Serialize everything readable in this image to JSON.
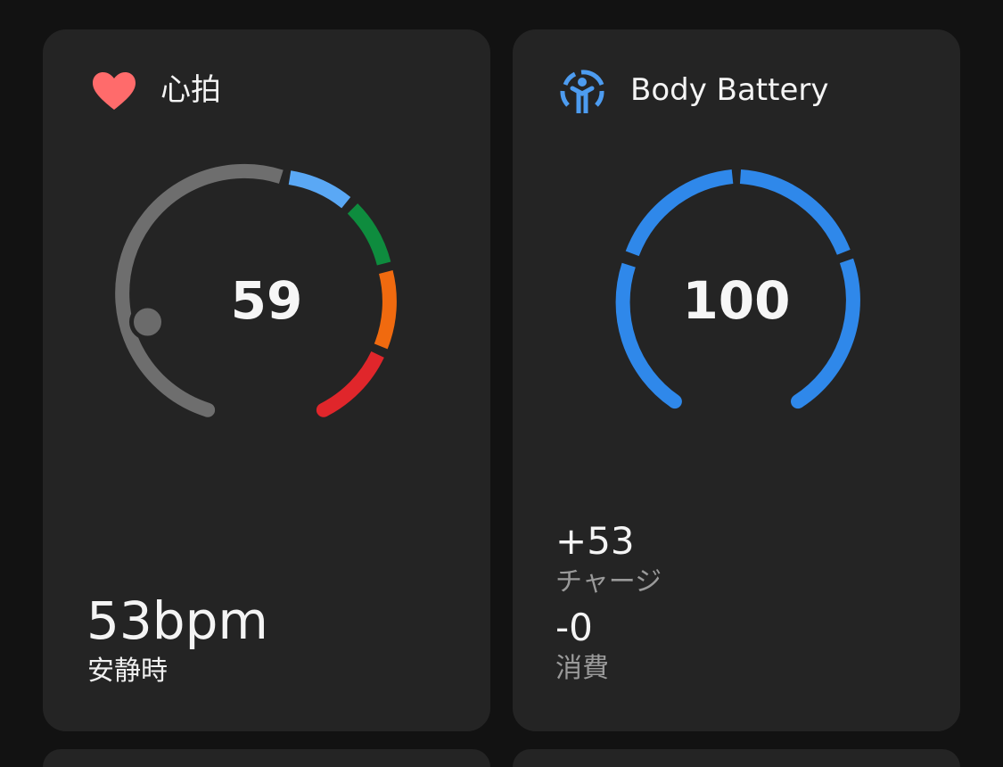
{
  "heart_rate": {
    "title": "心拍",
    "icon": "heart-icon",
    "gauge_value": "59",
    "resting_value": "53bpm",
    "resting_label": "安静時",
    "gauge_level": 59,
    "colors": {
      "accent": "#ff6b6b",
      "track": "#6e6e6e",
      "zone1": "#5aa8f5",
      "zone2": "#0e8c3e",
      "zone3": "#f06a0f",
      "zone4": "#e0262b"
    }
  },
  "body_battery": {
    "title": "Body Battery",
    "icon": "body-battery-icon",
    "gauge_value": "100",
    "level": 100,
    "charge_value": "+53",
    "charge_label": "チャージ",
    "drain_value": "-0",
    "drain_label": "消費",
    "colors": {
      "accent": "#2f88ea"
    }
  }
}
